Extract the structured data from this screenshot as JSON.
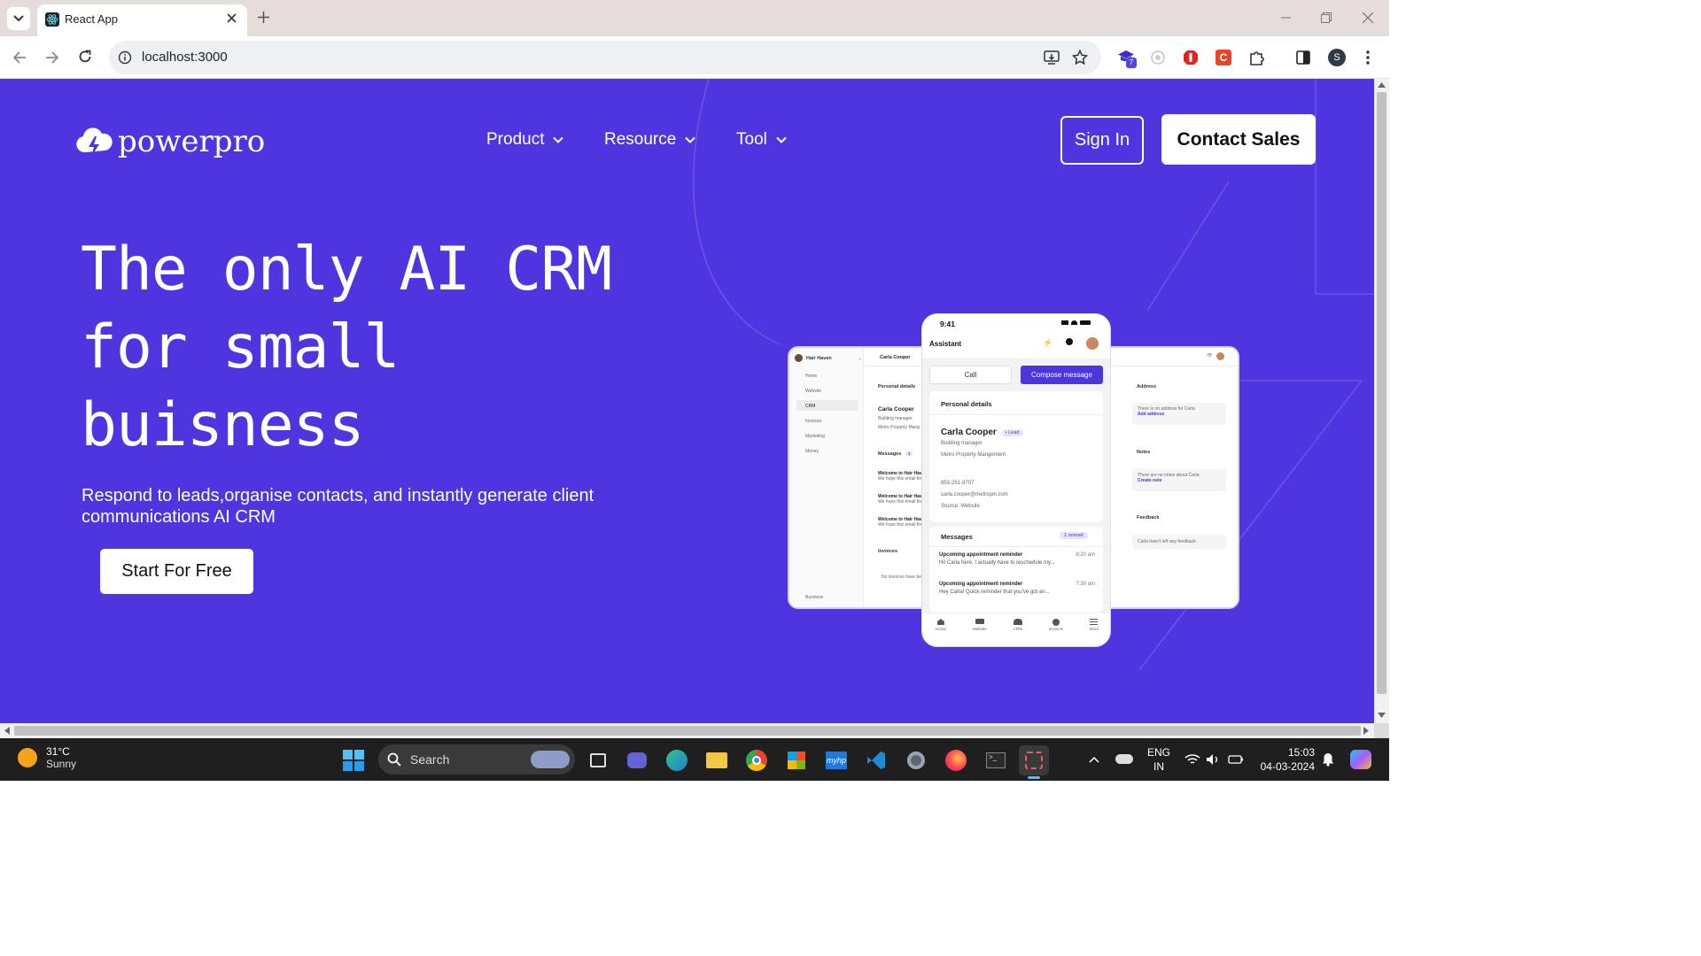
{
  "browser": {
    "tab_title": "React App",
    "url": "localhost:3000",
    "profile_initial": "S",
    "extension_badge": "7"
  },
  "site": {
    "logo_text": "powerpro",
    "nav": [
      {
        "label": "Product"
      },
      {
        "label": "Resource"
      },
      {
        "label": "Tool"
      }
    ],
    "sign_in": "Sign In",
    "contact_sales": "Contact Sales",
    "hero_line1": "The only AI CRM",
    "hero_line2": "for small",
    "hero_line3": "buisness",
    "subtitle": "Respond to leads,organise contacts, and instantly generate client communications AI CRM",
    "cta": "Start For Free",
    "colors": {
      "brand": "#4e35df",
      "accent": "#4b36de"
    }
  },
  "mock": {
    "desktop": {
      "workspace": "Hair Haven",
      "sidebar": [
        "Home",
        "Website",
        "CRM",
        "Invoices",
        "Marketing",
        "Money"
      ],
      "sidebar_footer": "Business",
      "contact_name": "Carla Cooper",
      "personal_details": "Personal details",
      "name": "Carla Cooper",
      "role": "Building manager",
      "company": "Metro Property Mang",
      "messages_title": "Messages",
      "messages_count": "1",
      "message_items": [
        {
          "title": "Welcome to Hair Have",
          "body": "We hope this email fin"
        },
        {
          "title": "Welcome to Hair Have",
          "body": "We hope this email fin"
        },
        {
          "title": "Welcome to Hair Have",
          "body": "We hope this email fin"
        }
      ],
      "invoices_title": "Invoices",
      "invoices_empty": "No invoices have be",
      "address_title": "Address",
      "address_empty": "There is no address for Carla",
      "address_link": "Add address",
      "notes_title": "Notes",
      "notes_empty": "There are no notes about Carla",
      "notes_link": "Create note",
      "feedback_title": "Feedback",
      "feedback_empty": "Carla hasn't left any feedback"
    },
    "phone": {
      "time": "9:41",
      "header": "Assistant",
      "call": "Call",
      "compose": "Compose message",
      "personal_details": "Personal details",
      "name": "Carla Cooper",
      "badge": "• Lead",
      "role": "Building manager",
      "company": "Metro Property Mangement",
      "phone": "953-251-9707",
      "email": "carla.cooper@metropm.com",
      "source": "Source: Website",
      "messages_title": "Messages",
      "unread": "1 unread",
      "messages": [
        {
          "title": "Upcoming appointment reminder",
          "time": "8:20 am",
          "body": "Hi! Carla here, I actually have to reschedule my..."
        },
        {
          "title": "Upcoming appointment reminder",
          "time": "7:30 am",
          "body": "Hey Carla! Quick reminder that you've got an..."
        }
      ],
      "bottom_nav": [
        "Home",
        "Website",
        "CRM",
        "Invoices",
        "More"
      ]
    }
  },
  "taskbar": {
    "temperature": "31°C",
    "weather": "Sunny",
    "search_placeholder": "Search",
    "lang1": "ENG",
    "lang2": "IN",
    "time": "15:03",
    "date": "04-03-2024"
  }
}
